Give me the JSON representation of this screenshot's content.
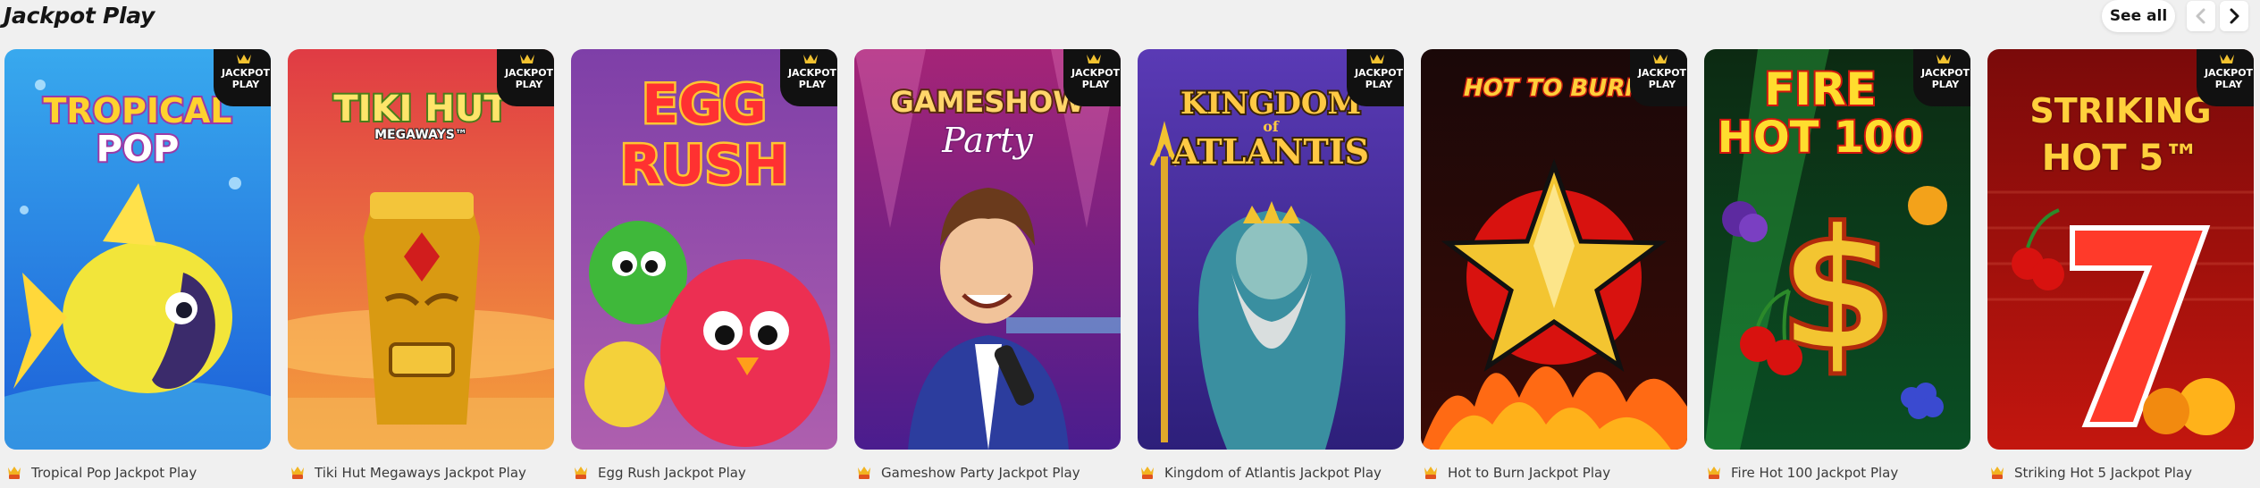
{
  "section": {
    "title": "Jackpot Play",
    "see_all_label": "See all"
  },
  "badge_text": {
    "line1": "JACKPOT",
    "line2": "PLAY"
  },
  "icons": {
    "prev": "chevron-left-icon",
    "next": "chevron-right-icon",
    "caption": "jackpot-play-logo-icon"
  },
  "colors": {
    "background": "#f0f0f0",
    "title": "#151515",
    "caption_text": "#3a3a3a",
    "badge_bg": "#111111"
  },
  "games": [
    {
      "caption": "Tropical Pop Jackpot Play",
      "art_title_lines": [
        "TROPICAL",
        "POP"
      ],
      "art_subtitle": "",
      "bg_top": "#38a9ee",
      "bg_bottom": "#1c5fd8",
      "title_fill": "#ffd22e",
      "title_stroke": "#9b3aa6"
    },
    {
      "caption": "Tiki Hut Megaways Jackpot Play",
      "art_title_lines": [
        "TIKI HUT"
      ],
      "art_subtitle": "MEGAWAYS™",
      "bg_top": "#e03b44",
      "bg_bottom": "#f5a23c",
      "title_fill": "#ffe56a",
      "title_stroke": "#4b7d1a"
    },
    {
      "caption": "Egg Rush Jackpot Play",
      "art_title_lines": [
        "EGG",
        "RUSH"
      ],
      "art_subtitle": "",
      "bg_top": "#7e3fa8",
      "bg_bottom": "#ae5fae",
      "title_fill": "#ff3131",
      "title_stroke": "#ffc531"
    },
    {
      "caption": "Gameshow Party Jackpot Play",
      "art_title_lines": [
        "GAMESHOW"
      ],
      "art_subtitle": "Party",
      "bg_top": "#a52477",
      "bg_bottom": "#4a1d8e",
      "title_fill": "#ffd56a",
      "title_stroke": "#5a2a10"
    },
    {
      "caption": "Kingdom of Atlantis Jackpot Play",
      "art_title_lines": [
        "KINGDOM",
        "ATLANTIS"
      ],
      "art_subtitle": "of",
      "bg_top": "#5a3ab5",
      "bg_bottom": "#2d1f7a",
      "title_fill": "#ffc944",
      "title_stroke": "#3b2408"
    },
    {
      "caption": "Hot to Burn Jackpot Play",
      "art_title_lines": [
        "HOT TO BURN"
      ],
      "art_subtitle": "",
      "bg_top": "#1a0808",
      "bg_bottom": "#3a0b06",
      "title_fill": "#ffcf3a",
      "title_stroke": "#c21a0f"
    },
    {
      "caption": "Fire Hot 100 Jackpot Play",
      "art_title_lines": [
        "FIRE",
        "HOT 100"
      ],
      "art_subtitle": "",
      "bg_top": "#0c2a12",
      "bg_bottom": "#0a4f24",
      "title_fill": "#ffdd2e",
      "title_stroke": "#d2160f"
    },
    {
      "caption": "Striking Hot 5 Jackpot Play",
      "art_title_lines": [
        "STRIKING",
        "HOT 5™"
      ],
      "art_subtitle": "",
      "bg_top": "#7a0a0a",
      "bg_bottom": "#c3160e",
      "title_fill": "#ffd13c",
      "title_stroke": "#7a0e0a"
    }
  ]
}
